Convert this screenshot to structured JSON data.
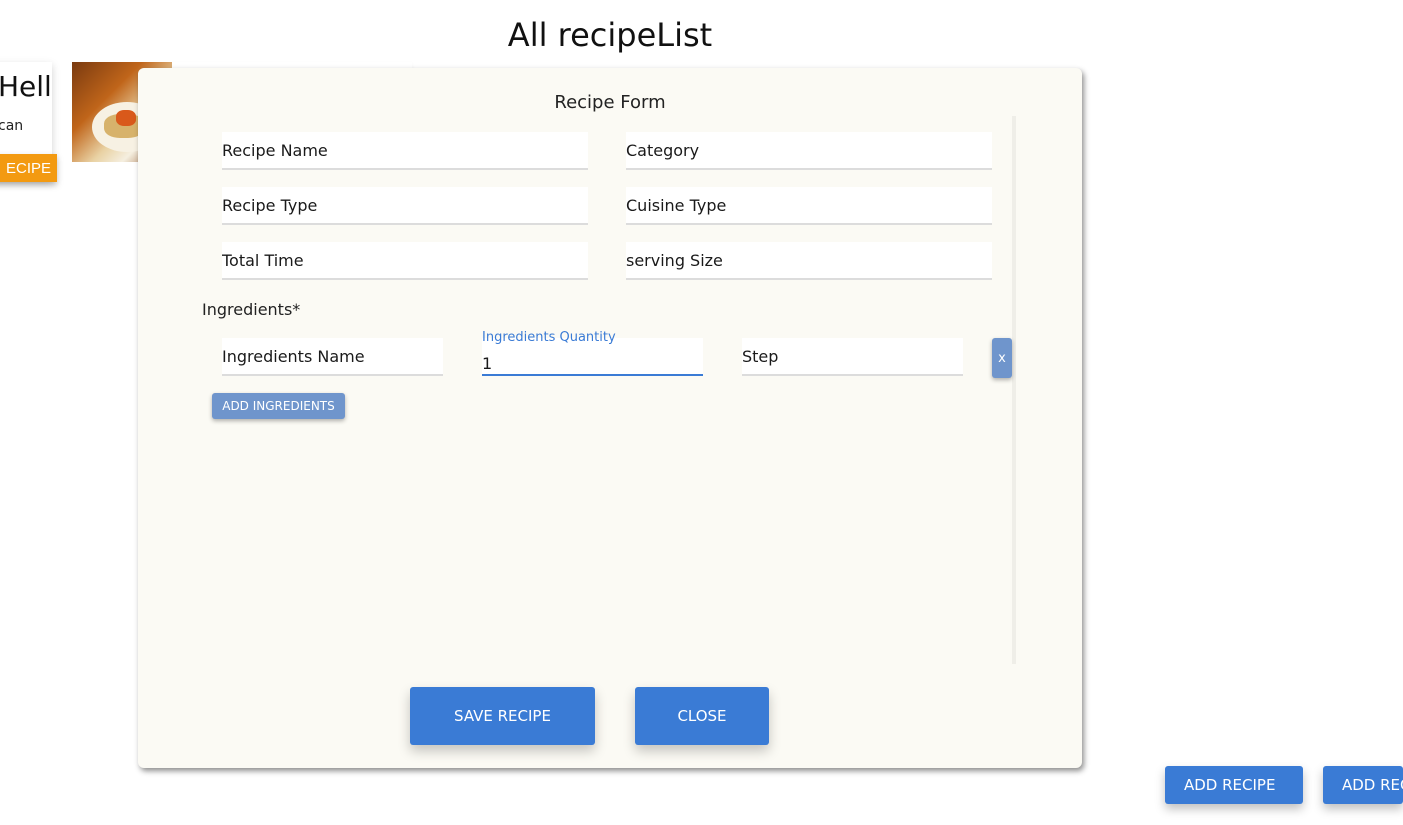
{
  "page": {
    "title": "All recipeList"
  },
  "background_card": {
    "title": "Hell",
    "text": "can",
    "button_label": "ECIPE"
  },
  "modal": {
    "title": "Recipe Form",
    "fields": {
      "recipe_name": {
        "placeholder": "Recipe Name"
      },
      "category": {
        "placeholder": "Category"
      },
      "recipe_type": {
        "placeholder": "Recipe Type"
      },
      "cuisine_type": {
        "placeholder": "Cuisine Type"
      },
      "total_time": {
        "placeholder": "Total Time"
      },
      "serving_size": {
        "placeholder": "serving Size"
      }
    },
    "ingredients": {
      "label": "Ingredients*",
      "name": {
        "placeholder": "Ingredients Name"
      },
      "quantity": {
        "label": "Ingredients Quantity",
        "value": "1"
      },
      "step": {
        "placeholder": "Step"
      },
      "remove_label": "x",
      "add_label": "ADD INGREDIENTS"
    },
    "save_label": "SAVE RECIPE",
    "close_label": "CLOSE"
  },
  "page_buttons": {
    "add_recipe_1": "ADD RECIPE",
    "add_recipe_2": "ADD RECIPE"
  },
  "colors": {
    "primary": "#3a7bd5",
    "secondary": "#6f95cc",
    "accent": "#f39a11",
    "modal_bg": "#fbfaf4"
  }
}
